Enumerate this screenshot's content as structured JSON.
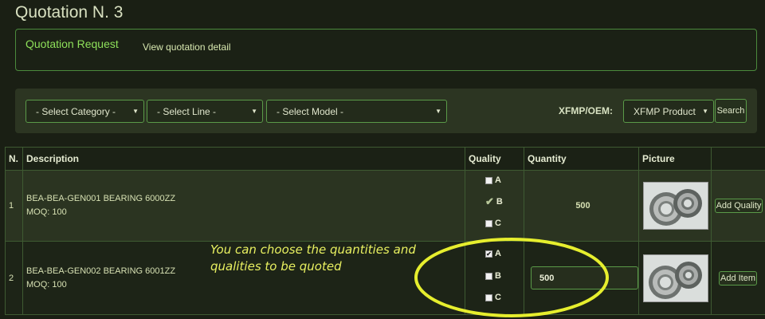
{
  "page": {
    "title": "Quotation N. 3"
  },
  "request_panel": {
    "title": "Quotation Request",
    "detail_link": "View quotation detail"
  },
  "filters": {
    "category": "- Select Category -",
    "line": "- Select Line -",
    "model": "- Select Model -",
    "oem_label": "XFMP/OEM:",
    "oem_value": "XFMP Product",
    "search_label": "Search"
  },
  "table": {
    "headers": [
      "N.",
      "Description",
      "Quality",
      "Quantity",
      "Picture",
      ""
    ],
    "rows": [
      {
        "n": "1",
        "description": "BEA-BEA-GEN001 BEARING 6000ZZ",
        "moq": "MOQ: 100",
        "qualities": [
          {
            "label": "A",
            "state": "unchecked"
          },
          {
            "label": "B",
            "state": "selected"
          },
          {
            "label": "C",
            "state": "unchecked"
          }
        ],
        "quantity": "500",
        "action": "Add Quality"
      },
      {
        "n": "2",
        "description": "BEA-BEA-GEN002 BEARING 6001ZZ",
        "moq": "MOQ: 100",
        "qualities": [
          {
            "label": "A",
            "state": "checked"
          },
          {
            "label": "B",
            "state": "unchecked"
          },
          {
            "label": "C",
            "state": "unchecked"
          }
        ],
        "quantity": "500",
        "action": "Add Item"
      }
    ]
  },
  "annotation": {
    "line1": "You can choose the quantities and",
    "line2": "qualities to be quoted",
    "color": "#e8f060"
  },
  "icons": {
    "caret": "chevron-down-icon",
    "check": "check-icon",
    "picture": "bearing-image"
  }
}
